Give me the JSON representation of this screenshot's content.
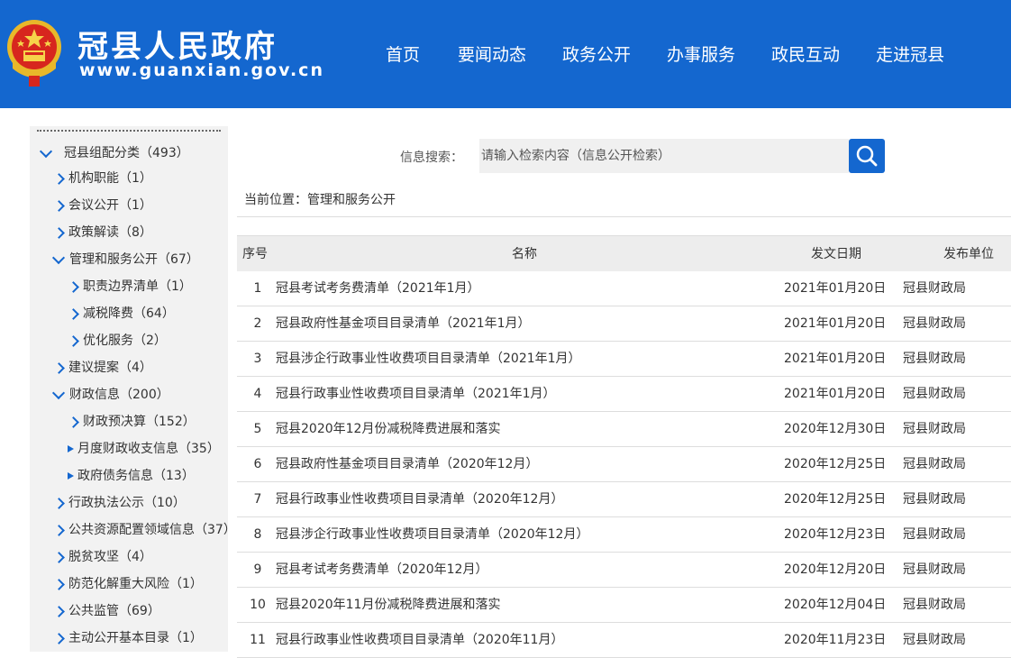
{
  "header": {
    "title": "冠县人民政府",
    "url": "www.guanxian.gov.cn",
    "nav": [
      "首页",
      "要闻动态",
      "政务公开",
      "办事服务",
      "政民互动",
      "走进冠县"
    ]
  },
  "colors": {
    "brand": "#1467cf",
    "sidebar_bg": "#f2f2f2",
    "table_header_bg": "#ededed"
  },
  "sidebar": {
    "items": [
      {
        "label": "冠县组配分类（493）",
        "icon": "chevron-down-icon"
      },
      {
        "label": "机构职能（1）",
        "icon": "chevron-right-icon"
      },
      {
        "label": "会议公开（1）",
        "icon": "chevron-right-icon"
      },
      {
        "label": "政策解读（8）",
        "icon": "chevron-right-icon"
      },
      {
        "label": "管理和服务公开（67）",
        "icon": "chevron-down-icon"
      },
      {
        "label": "职责边界清单（1）",
        "icon": "chevron-right-icon"
      },
      {
        "label": "减税降费（64）",
        "icon": "chevron-right-icon"
      },
      {
        "label": "优化服务（2）",
        "icon": "chevron-right-icon"
      },
      {
        "label": "建议提案（4）",
        "icon": "chevron-right-icon"
      },
      {
        "label": "财政信息（200）",
        "icon": "chevron-down-icon"
      },
      {
        "label": "财政预决算（152）",
        "icon": "chevron-right-icon"
      },
      {
        "label": "月度财政收支信息（35）",
        "icon": "triangle-right-icon"
      },
      {
        "label": "政府债务信息（13）",
        "icon": "triangle-right-icon"
      },
      {
        "label": "行政执法公示（10）",
        "icon": "chevron-right-icon"
      },
      {
        "label": "公共资源配置领域信息（37）",
        "icon": "chevron-right-icon"
      },
      {
        "label": "脱贫攻坚（4）",
        "icon": "chevron-right-icon"
      },
      {
        "label": "防范化解重大风险（1）",
        "icon": "chevron-right-icon"
      },
      {
        "label": "公共监管（69）",
        "icon": "chevron-right-icon"
      },
      {
        "label": "主动公开基本目录（1）",
        "icon": "chevron-right-icon"
      }
    ]
  },
  "search": {
    "label": "信息搜索：",
    "placeholder": "请输入检索内容（信息公开检索）",
    "button_icon": "search-icon"
  },
  "breadcrumb": "当前位置：管理和服务公开",
  "table": {
    "columns": [
      "序号",
      "名称",
      "发文日期",
      "发布单位"
    ],
    "rows": [
      {
        "idx": "1",
        "name": "冠县考试考务费清单（2021年1月）",
        "date": "2021年01月20日",
        "unit": "冠县财政局"
      },
      {
        "idx": "2",
        "name": "冠县政府性基金项目目录清单（2021年1月）",
        "date": "2021年01月20日",
        "unit": "冠县财政局"
      },
      {
        "idx": "3",
        "name": "冠县涉企行政事业性收费项目目录清单（2021年1月）",
        "date": "2021年01月20日",
        "unit": "冠县财政局"
      },
      {
        "idx": "4",
        "name": "冠县行政事业性收费项目目录清单（2021年1月）",
        "date": "2021年01月20日",
        "unit": "冠县财政局"
      },
      {
        "idx": "5",
        "name": "冠县2020年12月份减税降费进展和落实",
        "date": "2020年12月30日",
        "unit": "冠县财政局"
      },
      {
        "idx": "6",
        "name": "冠县政府性基金项目目录清单（2020年12月）",
        "date": "2020年12月25日",
        "unit": "冠县财政局"
      },
      {
        "idx": "7",
        "name": "冠县行政事业性收费项目目录清单（2020年12月）",
        "date": "2020年12月25日",
        "unit": "冠县财政局"
      },
      {
        "idx": "8",
        "name": "冠县涉企行政事业性收费项目目录清单（2020年12月）",
        "date": "2020年12月23日",
        "unit": "冠县财政局"
      },
      {
        "idx": "9",
        "name": "冠县考试考务费清单（2020年12月）",
        "date": "2020年12月20日",
        "unit": "冠县财政局"
      },
      {
        "idx": "10",
        "name": "冠县2020年11月份减税降费进展和落实",
        "date": "2020年12月04日",
        "unit": "冠县财政局"
      },
      {
        "idx": "11",
        "name": "冠县行政事业性收费项目目录清单（2020年11月）",
        "date": "2020年11月23日",
        "unit": "冠县财政局"
      }
    ]
  }
}
